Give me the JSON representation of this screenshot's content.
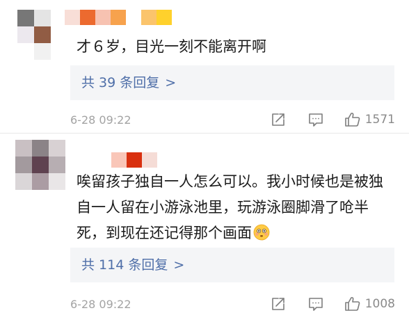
{
  "comments": [
    {
      "text": "才６岁，目光一刻不能离开啊",
      "replies_label": "共 39 条回复",
      "replies_chevron": ">",
      "timestamp": "6-28 09:22",
      "likes": "1571",
      "avatar_mosaic": [
        "#777777",
        "#e4e4e4",
        "#ece8ee",
        "#915c44",
        "#ffffff",
        "#f1f1f1"
      ],
      "username_mosaic": [
        "#f8ded7",
        "#ec6a2f",
        "#f7c2b1",
        "#f7a24d",
        "#ffffff",
        "#fbc46c",
        "#ffd12c"
      ]
    },
    {
      "text": "唉留孩子独自一人怎么可以。我小时候也是被独自一人留在小游泳池里，玩游泳圈脚滑了呛半死，到现在还记得那个画面",
      "emoji": "flushed-face-emoji",
      "replies_label": "共 114 条回复",
      "replies_chevron": ">",
      "timestamp": "6-28 09:22",
      "likes": "1008",
      "avatar_mosaic": [
        "#c9c0c3",
        "#8b8387",
        "#d8d1d3",
        "#a39a9e",
        "#5f4250",
        "#b7aeb2",
        "#dad6d8",
        "#ab9ca3",
        "#e9e6e7"
      ],
      "username_mosaic": [
        "#f9c6b8",
        "#d9300f",
        "#f5dcd6"
      ]
    }
  ],
  "icons": {
    "share": "share-icon",
    "comment": "comment-icon",
    "like": "thumbs-up-icon"
  },
  "colors": {
    "reply_link": "#4e6ea8",
    "reply_bg": "#f4f5f7",
    "meta_text": "#a3a3a3"
  }
}
